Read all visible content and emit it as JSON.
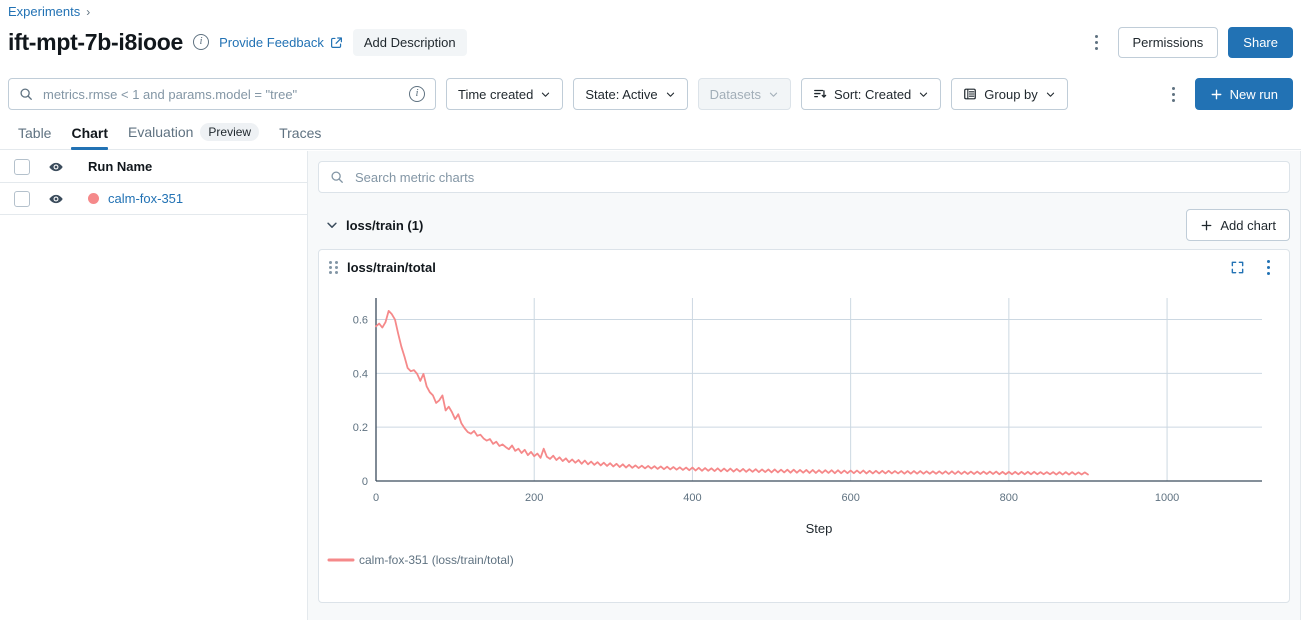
{
  "breadcrumb": {
    "root": "Experiments",
    "separator": "›"
  },
  "header": {
    "title": "ift-mpt-7b-i8iooe",
    "info_icon": "info-icon",
    "feedback_label": "Provide Feedback",
    "external_link_icon": "external-link-icon",
    "add_description_label": "Add Description",
    "overflow_icon": "kebab-menu-icon",
    "permissions_label": "Permissions",
    "share_label": "Share"
  },
  "toolbar": {
    "search_placeholder": "metrics.rmse < 1 and params.model = \"tree\"",
    "search_value": "",
    "search_icon": "search-icon",
    "search_info_icon": "info-icon",
    "time_created_label": "Time created",
    "state_label": "State: Active",
    "datasets_label": "Datasets",
    "datasets_disabled": true,
    "sort_label": "Sort: Created",
    "sort_icon": "sort-icon",
    "group_by_label": "Group by",
    "group_by_icon": "table-icon",
    "overflow_icon": "kebab-menu-icon",
    "new_run_label": "New run",
    "new_run_icon": "plus-icon"
  },
  "tabs": [
    {
      "label": "Table",
      "active": false,
      "badge": ""
    },
    {
      "label": "Chart",
      "active": true,
      "badge": ""
    },
    {
      "label": "Evaluation",
      "active": false,
      "badge": "Preview"
    },
    {
      "label": "Traces",
      "active": false,
      "badge": ""
    }
  ],
  "runs_panel": {
    "header": {
      "checkbox_icon": "checkbox-icon",
      "visibility_icon": "eye-icon",
      "run_name_label": "Run Name"
    },
    "rows": [
      {
        "checkbox_icon": "checkbox-icon",
        "visibility_icon": "eye-icon",
        "color": "#f5898a",
        "name": "calm-fox-351"
      }
    ]
  },
  "charts_panel": {
    "search_placeholder": "Search metric charts",
    "search_value": "",
    "search_icon": "search-icon",
    "group": {
      "collapse_icon": "chevron-down-icon",
      "label": "loss/train (1)",
      "add_chart_label": "Add chart",
      "add_chart_icon": "plus-icon"
    },
    "card": {
      "drag_icon": "drag-handle-icon",
      "title": "loss/train/total",
      "fullscreen_icon": "fullscreen-icon",
      "overflow_icon": "kebab-menu-icon"
    }
  },
  "chart_data": {
    "type": "line",
    "title": "loss/train/total",
    "xlabel": "Step",
    "ylabel": "",
    "xlim": [
      0,
      1120
    ],
    "ylim": [
      0,
      0.68
    ],
    "xticks": [
      0,
      200,
      400,
      600,
      800,
      1000
    ],
    "yticks": [
      0,
      0.2,
      0.4,
      0.6
    ],
    "ytick_labels": [
      "0",
      "0.2",
      "0.4",
      "0.6"
    ],
    "grid": true,
    "legend_position": "bottom-left",
    "series": [
      {
        "name": "calm-fox-351 (loss/train/total)",
        "color": "#f5898a",
        "run": "calm-fox-351",
        "metric": "loss/train/total",
        "x_start": 0,
        "x_step": 4,
        "values": [
          0.575,
          0.585,
          0.57,
          0.59,
          0.632,
          0.62,
          0.6,
          0.548,
          0.5,
          0.462,
          0.42,
          0.408,
          0.412,
          0.398,
          0.372,
          0.398,
          0.352,
          0.33,
          0.318,
          0.29,
          0.3,
          0.318,
          0.262,
          0.276,
          0.256,
          0.23,
          0.248,
          0.214,
          0.196,
          0.182,
          0.176,
          0.186,
          0.168,
          0.172,
          0.158,
          0.15,
          0.156,
          0.138,
          0.146,
          0.13,
          0.136,
          0.126,
          0.118,
          0.132,
          0.112,
          0.12,
          0.104,
          0.116,
          0.096,
          0.108,
          0.092,
          0.102,
          0.086,
          0.12,
          0.09,
          0.082,
          0.094,
          0.078,
          0.088,
          0.074,
          0.084,
          0.07,
          0.08,
          0.068,
          0.078,
          0.064,
          0.076,
          0.062,
          0.072,
          0.06,
          0.07,
          0.058,
          0.068,
          0.056,
          0.066,
          0.054,
          0.064,
          0.052,
          0.062,
          0.05,
          0.06,
          0.049,
          0.058,
          0.048,
          0.057,
          0.047,
          0.056,
          0.046,
          0.055,
          0.045,
          0.054,
          0.044,
          0.053,
          0.043,
          0.052,
          0.042,
          0.051,
          0.041,
          0.05,
          0.04,
          0.05,
          0.039,
          0.049,
          0.038,
          0.048,
          0.038,
          0.047,
          0.037,
          0.047,
          0.036,
          0.046,
          0.036,
          0.046,
          0.035,
          0.045,
          0.035,
          0.045,
          0.034,
          0.044,
          0.034,
          0.044,
          0.033,
          0.043,
          0.033,
          0.043,
          0.032,
          0.043,
          0.032,
          0.042,
          0.032,
          0.042,
          0.031,
          0.042,
          0.031,
          0.041,
          0.031,
          0.041,
          0.03,
          0.041,
          0.03,
          0.04,
          0.03,
          0.04,
          0.03,
          0.04,
          0.029,
          0.04,
          0.029,
          0.039,
          0.029,
          0.039,
          0.029,
          0.039,
          0.029,
          0.039,
          0.028,
          0.038,
          0.028,
          0.038,
          0.028,
          0.038,
          0.028,
          0.038,
          0.028,
          0.037,
          0.028,
          0.037,
          0.027,
          0.037,
          0.027,
          0.037,
          0.027,
          0.037,
          0.027,
          0.036,
          0.027,
          0.036,
          0.027,
          0.036,
          0.027,
          0.036,
          0.026,
          0.036,
          0.026,
          0.036,
          0.026,
          0.035,
          0.026,
          0.035,
          0.026,
          0.035,
          0.026,
          0.035,
          0.026,
          0.035,
          0.026,
          0.035,
          0.025,
          0.034,
          0.025,
          0.034,
          0.025,
          0.034,
          0.025,
          0.034,
          0.025,
          0.034,
          0.025,
          0.034,
          0.025,
          0.033,
          0.025,
          0.033,
          0.025,
          0.033,
          0.024,
          0.033,
          0.024,
          0.033,
          0.024,
          0.033,
          0.024,
          0.032,
          0.024,
          0.032,
          0.024
        ]
      }
    ]
  }
}
